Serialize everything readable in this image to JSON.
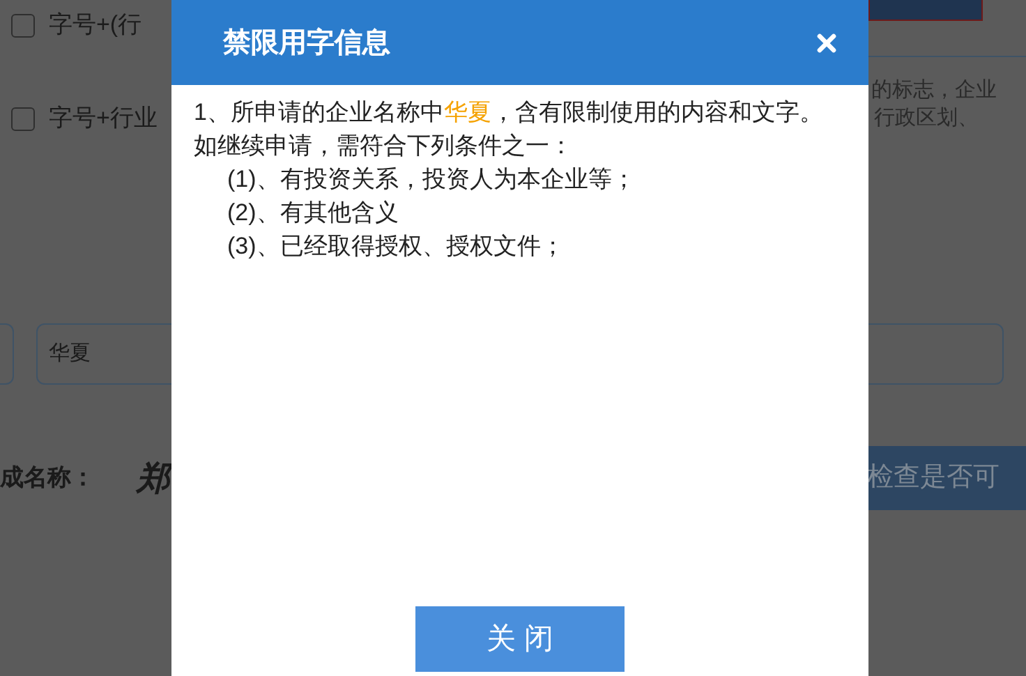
{
  "background": {
    "options": [
      {
        "label": "字号+(行",
        "checked": false
      },
      {
        "label": "字号+行业",
        "checked": false
      }
    ],
    "hint_lines": [
      "的标志，企业",
      "行政区划、"
    ],
    "name_field": {
      "value": "华夏"
    },
    "result_label": "成名称：",
    "result_value": "郑",
    "check_button": "检查是否可"
  },
  "dialog": {
    "title": "禁限用字信息",
    "notice": {
      "before": "1、所申请的企业名称中",
      "highlight": "华夏",
      "after": "，含有限制使用的内容和文字。"
    },
    "intro": "如继续申请，需符合下列条件之一：",
    "conditions": [
      "(1)、有投资关系，投资人为本企业等；",
      "(2)、有其他含义",
      "(3)、已经取得授权、授权文件；"
    ],
    "close_button": "关 闭"
  }
}
